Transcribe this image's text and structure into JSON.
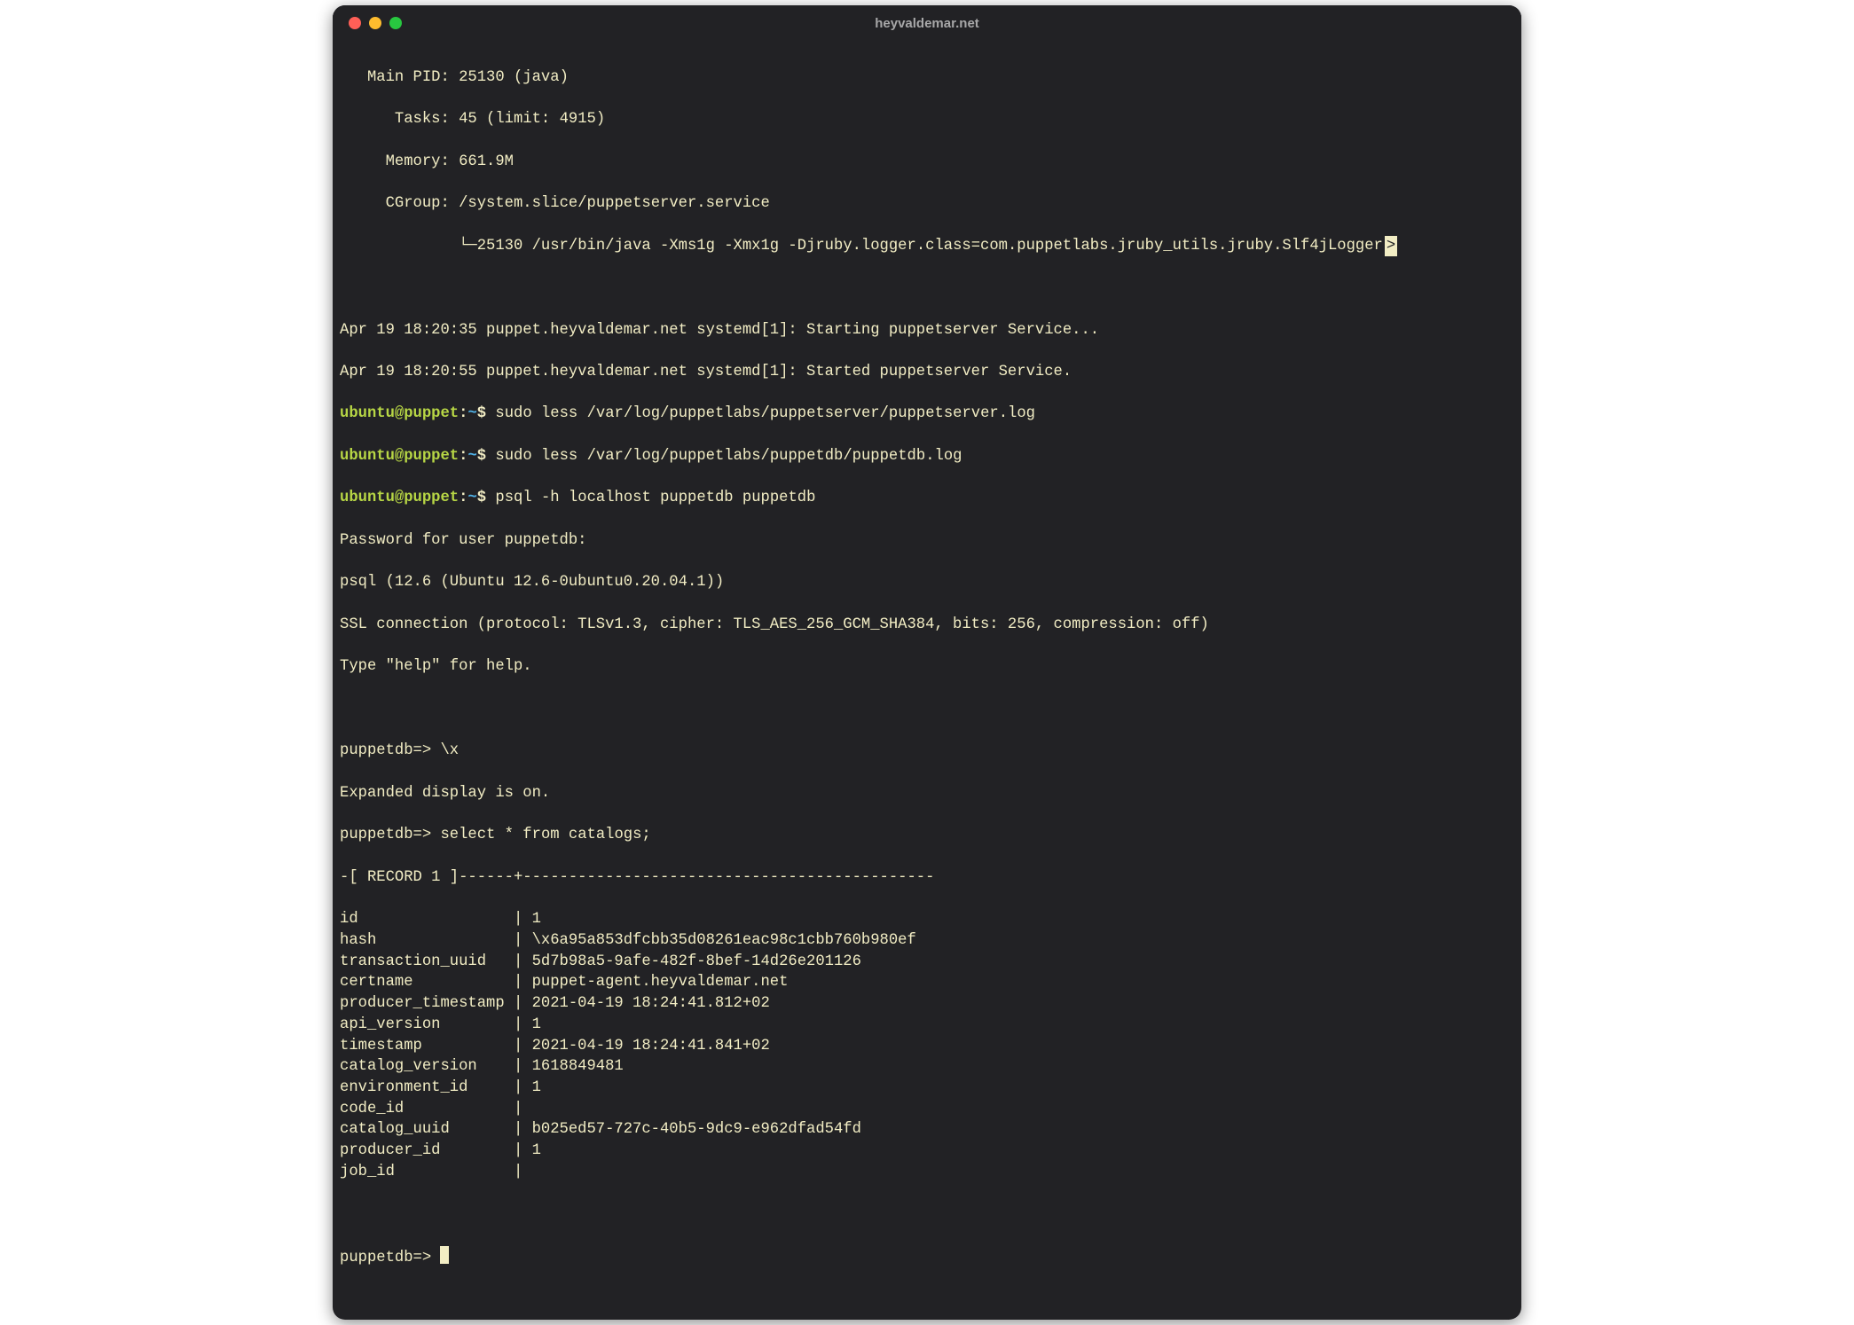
{
  "window": {
    "title": "heyvaldemar.net"
  },
  "colors": {
    "bg": "#222225",
    "fg": "#f2edc4",
    "prompt_user": "#b7d645",
    "prompt_path": "#50b2e6",
    "red": "#ff5f57",
    "yellow": "#febc2e",
    "green": "#28c840"
  },
  "systemctl": {
    "main_pid_label": "Main PID:",
    "main_pid": "25130 (java)",
    "tasks_label": "Tasks:",
    "tasks": "45 (limit: 4915)",
    "memory_label": "Memory:",
    "memory": "661.9M",
    "cgroup_label": "CGroup:",
    "cgroup": "/system.slice/puppetserver.service",
    "proc_line": "25130 /usr/bin/java -Xms1g -Xmx1g -Djruby.logger.class=com.puppetlabs.jruby_utils.jruby.Slf4jLogger",
    "truncated_marker": ">"
  },
  "journal": {
    "line1": "Apr 19 18:20:35 puppet.heyvaldemar.net systemd[1]: Starting puppetserver Service...",
    "line2": "Apr 19 18:20:55 puppet.heyvaldemar.net systemd[1]: Started puppetserver Service."
  },
  "prompt": {
    "user": "ubuntu",
    "at": "@",
    "host": "puppet",
    "colon": ":",
    "path": "~",
    "sigil": "$"
  },
  "commands": {
    "c1": "sudo less /var/log/puppetlabs/puppetserver/puppetserver.log",
    "c2": "sudo less /var/log/puppetlabs/puppetdb/puppetdb.log",
    "c3": "psql -h localhost puppetdb puppetdb"
  },
  "psql": {
    "password_prompt": "Password for user puppetdb:",
    "banner": "psql (12.6 (Ubuntu 12.6-0ubuntu0.20.04.1))",
    "ssl": "SSL connection (protocol: TLSv1.3, cipher: TLS_AES_256_GCM_SHA384, bits: 256, compression: off)",
    "help_hint": "Type \"help\" for help.",
    "prompt": "puppetdb=>",
    "cmd_x": "\\x",
    "expanded_on": "Expanded display is on.",
    "cmd_select": "select * from catalogs;",
    "record_header": "-[ RECORD 1 ]------+---------------------------------------------"
  },
  "record": {
    "rows": [
      {
        "k": "id",
        "v": "1"
      },
      {
        "k": "hash",
        "v": "\\x6a95a853dfcbb35d08261eac98c1cbb760b980ef"
      },
      {
        "k": "transaction_uuid",
        "v": "5d7b98a5-9afe-482f-8bef-14d26e201126"
      },
      {
        "k": "certname",
        "v": "puppet-agent.heyvaldemar.net"
      },
      {
        "k": "producer_timestamp",
        "v": "2021-04-19 18:24:41.812+02"
      },
      {
        "k": "api_version",
        "v": "1"
      },
      {
        "k": "timestamp",
        "v": "2021-04-19 18:24:41.841+02"
      },
      {
        "k": "catalog_version",
        "v": "1618849481"
      },
      {
        "k": "environment_id",
        "v": "1"
      },
      {
        "k": "code_id",
        "v": ""
      },
      {
        "k": "catalog_uuid",
        "v": "b025ed57-727c-40b5-9dc9-e962dfad54fd"
      },
      {
        "k": "producer_id",
        "v": "1"
      },
      {
        "k": "job_id",
        "v": ""
      }
    ]
  },
  "tree_elbow": "└─"
}
